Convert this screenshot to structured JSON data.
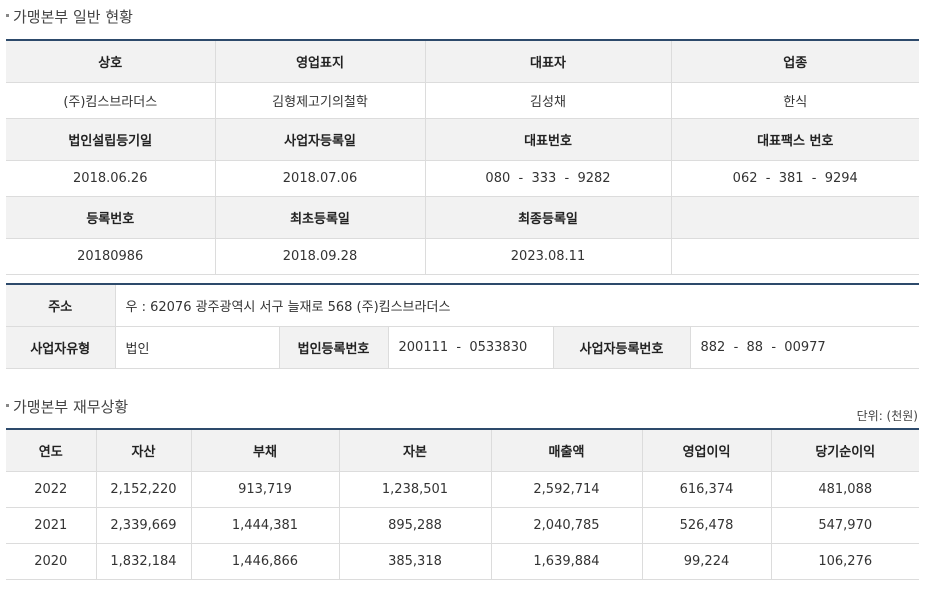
{
  "general": {
    "title": "가맹본부 일반 현황",
    "labels": {
      "company_name": "상호",
      "brand": "영업표지",
      "ceo": "대표자",
      "industry": "업종",
      "incorporation_date": "법인설립등기일",
      "business_reg_date": "사업자등록일",
      "phone": "대표번호",
      "fax": "대표팩스 번호",
      "registration_no": "등록번호",
      "first_reg_date": "최초등록일",
      "last_reg_date": "최종등록일"
    },
    "values": {
      "company_name": "(주)킴스브라더스",
      "brand": "김형제고기의철학",
      "ceo": "김성채",
      "industry": "한식",
      "incorporation_date": "2018.06.26",
      "business_reg_date": "2018.07.06",
      "phone": "080  -  333  -  9282",
      "fax": "062  -  381  -  9294",
      "registration_no": "20180986",
      "first_reg_date": "2018.09.28",
      "last_reg_date": "2023.08.11"
    }
  },
  "address": {
    "labels": {
      "address": "주소",
      "business_type": "사업자유형",
      "corp_reg_no": "법인등록번호",
      "business_reg_no": "사업자등록번호"
    },
    "values": {
      "address": "우 : 62076 광주광역시 서구 늘재로 568 (주)킴스브라더스",
      "business_type": "법인",
      "corp_reg_no": "200111  -  0533830",
      "business_reg_no": "882  -  88  -  00977"
    }
  },
  "finance": {
    "title": "가맹본부 재무상황",
    "unit": "단위: (천원)",
    "headers": [
      "연도",
      "자산",
      "부채",
      "자본",
      "매출액",
      "영업이익",
      "당기순이익"
    ],
    "rows": [
      [
        "2022",
        "2,152,220",
        "913,719",
        "1,238,501",
        "2,592,714",
        "616,374",
        "481,088"
      ],
      [
        "2021",
        "2,339,669",
        "1,444,381",
        "895,288",
        "2,040,785",
        "526,478",
        "547,970"
      ],
      [
        "2020",
        "1,832,184",
        "1,446,866",
        "385,318",
        "1,639,884",
        "99,224",
        "106,276"
      ]
    ]
  }
}
